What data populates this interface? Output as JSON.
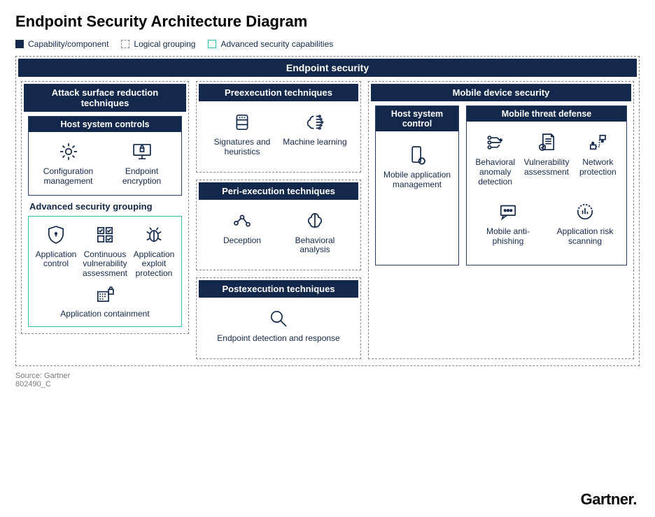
{
  "title": "Endpoint Security Architecture Diagram",
  "legend": {
    "cap": "Capability/component",
    "log": "Logical grouping",
    "adv": "Advanced security capabilities"
  },
  "banner": "Endpoint security",
  "col1": {
    "group_title": "Attack surface reduction techniques",
    "host": {
      "title": "Host system controls",
      "items": [
        "Configuration management",
        "Endpoint encryption"
      ]
    },
    "adv_title": "Advanced security grouping",
    "adv_items": [
      "Application control",
      "Continuous vulnerability assessment",
      "Application exploit protection",
      "Application containment"
    ]
  },
  "col2": {
    "pre": {
      "title": "Preexecution techniques",
      "items": [
        "Signatures and heuristics",
        "Machine learning"
      ]
    },
    "peri": {
      "title": "Peri-execution techniques",
      "items": [
        "Deception",
        "Behavioral analysis"
      ]
    },
    "post": {
      "title": "Postexecution techniques",
      "items": [
        "Endpoint detection and response"
      ]
    }
  },
  "col3": {
    "title": "Mobile device security",
    "host": {
      "title": "Host system control",
      "items": [
        "Mobile application management"
      ]
    },
    "threat": {
      "title": "Mobile threat defense",
      "items": [
        "Behavioral anomaly detection",
        "Vulnerability assessment",
        "Network protection",
        "Mobile anti-phishing",
        "Application risk scanning"
      ]
    }
  },
  "footer": {
    "source": "Source: Gartner",
    "id": "802490_C"
  },
  "brand": "Gartner."
}
